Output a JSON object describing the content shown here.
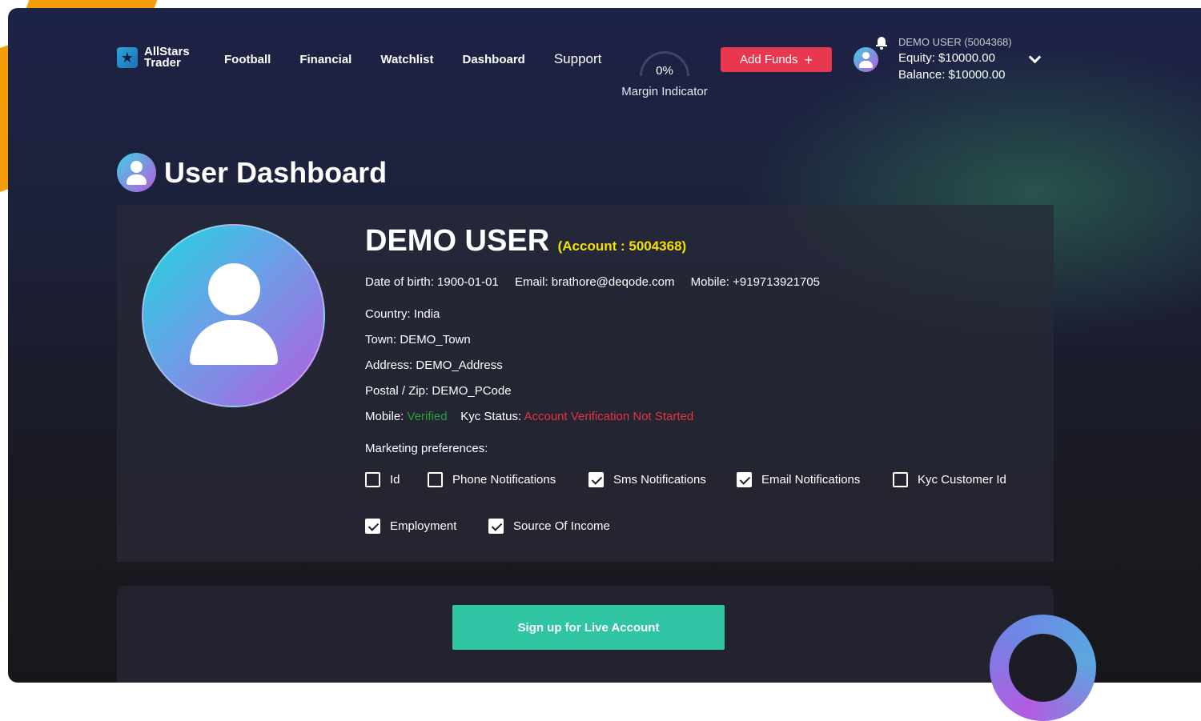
{
  "brand": {
    "name_line1": "AllStars",
    "name_line2": "Trader",
    "logo_icon": "star-icon"
  },
  "nav": {
    "items": [
      {
        "label": "Football"
      },
      {
        "label": "Financial"
      },
      {
        "label": "Watchlist"
      },
      {
        "label": "Dashboard"
      },
      {
        "label": "Support"
      }
    ]
  },
  "margin": {
    "value": "0%",
    "label": "Margin Indicator"
  },
  "add_funds": {
    "label": "Add Funds",
    "icon": "+"
  },
  "account_summary": {
    "user": "DEMO USER (5004368)",
    "equity": "Equity: $10000.00",
    "balance": "Balance: $10000.00"
  },
  "page": {
    "title": "User Dashboard"
  },
  "profile": {
    "name": "DEMO USER",
    "account": "(Account : 5004368)",
    "dob": "Date of birth: 1900-01-01",
    "email": "Email: brathore@deqode.com",
    "mobile": "Mobile: +919713921705",
    "country": "Country: India",
    "town": "Town: DEMO_Town",
    "address": "Address: DEMO_Address",
    "postal": "Postal / Zip: DEMO_PCode",
    "mobile_label": "Mobile:",
    "mobile_status": "Verified",
    "kyc_label": "Kyc Status:",
    "kyc_status": "Account Verification Not Started",
    "marketing_label": "Marketing preferences:"
  },
  "preferences": [
    {
      "label": "Id",
      "checked": false
    },
    {
      "label": "Phone Notifications",
      "checked": false
    },
    {
      "label": "Sms Notifications",
      "checked": true
    },
    {
      "label": "Email Notifications",
      "checked": true
    },
    {
      "label": "Kyc Customer Id",
      "checked": false
    },
    {
      "label": "Employment",
      "checked": true
    },
    {
      "label": "Source Of Income",
      "checked": true
    }
  ],
  "cta": {
    "label": "Sign up for Live Account"
  },
  "colors": {
    "accent_red": "#e8384f",
    "accent_teal": "#2ec4a4",
    "account_yellow": "#f5e000",
    "verified_green": "#2e9e3a",
    "kyc_red": "#e8333f"
  }
}
